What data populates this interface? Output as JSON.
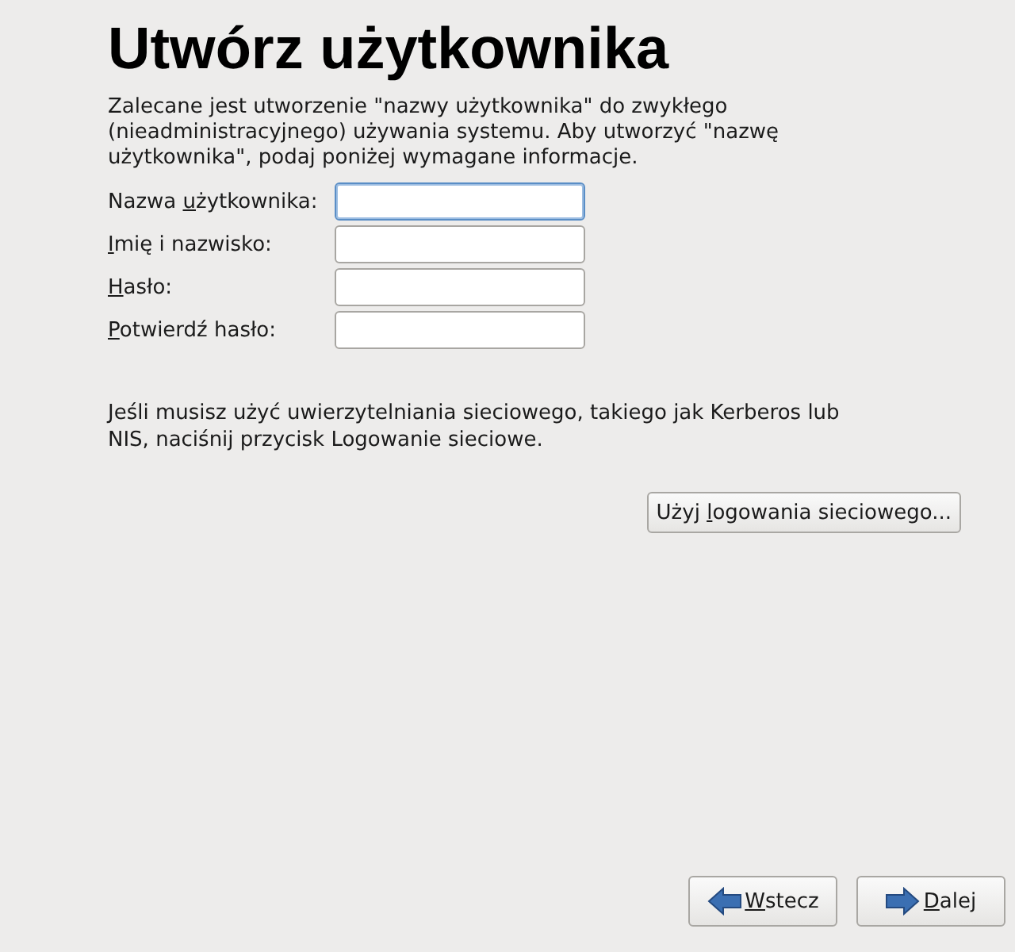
{
  "title": "Utwórz użytkownika",
  "intro": "Zalecane jest utworzenie \"nazwy użytkownika\" do zwykłego (nieadministracyjnego) używania systemu. Aby utworzyć \"nazwę użytkownika\", podaj poniżej wymagane informacje.",
  "fields": [
    {
      "label": {
        "pre": "Nazwa ",
        "key": "u",
        "post": "żytkownika:"
      },
      "focused": true
    },
    {
      "label": {
        "key": "I",
        "post": "mię i nazwisko:"
      },
      "focused": false
    },
    {
      "label": {
        "key": "H",
        "post": "asło:"
      },
      "focused": false
    },
    {
      "label": {
        "key": "P",
        "post": "otwierdź hasło:"
      },
      "focused": false
    }
  ],
  "network_note": "Jeśli musisz użyć uwierzytelniania sieciowego, takiego jak Kerberos lub NIS, naciśnij przycisk Logowanie sieciowe.",
  "network_button": {
    "pre": "Użyj ",
    "key": "l",
    "post": "ogowania sieciowego..."
  },
  "nav_buttons": [
    {
      "kind": "back",
      "label": {
        "key": "W",
        "post": "stecz"
      }
    },
    {
      "kind": "next",
      "label": {
        "key": "D",
        "post": "alej"
      }
    }
  ]
}
